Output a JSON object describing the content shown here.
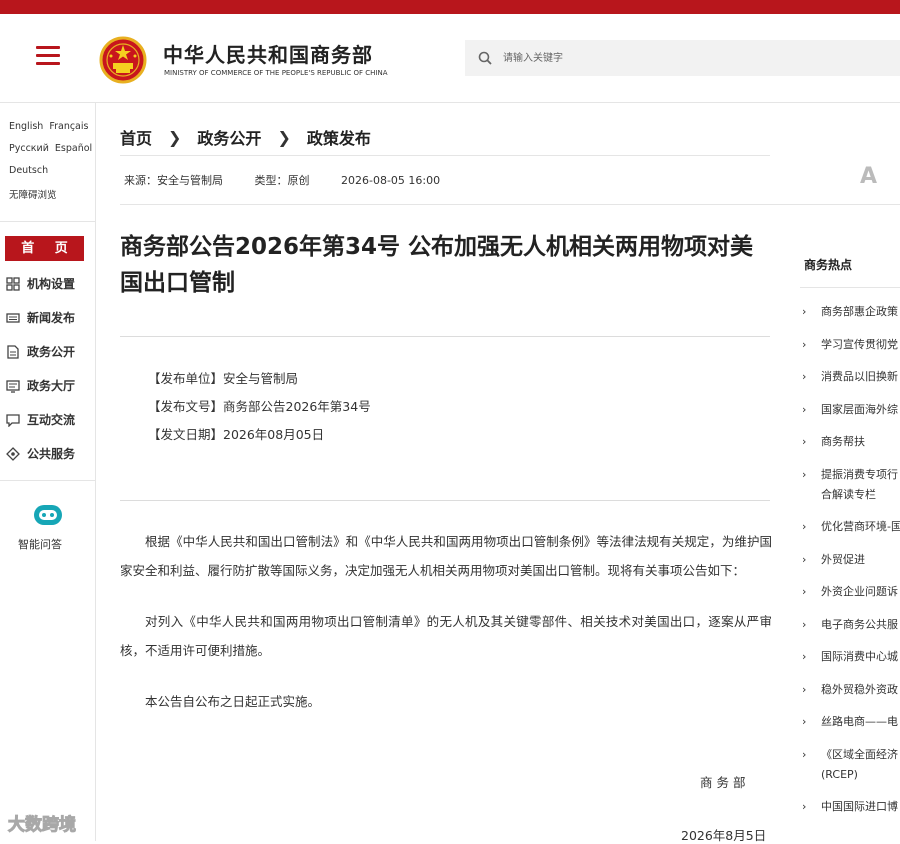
{
  "header": {
    "logo_cn": "中华人民共和国商务部",
    "logo_en": "MINISTRY OF COMMERCE OF THE PEOPLE'S REPUBLIC OF CHINA",
    "search_placeholder": "请输入关键字",
    "accent_color": "#b8161c"
  },
  "sidebar": {
    "languages": [
      "English",
      "Français",
      "Русский",
      "Español",
      "Deutsch",
      "无障碍浏览"
    ],
    "home": "首 页",
    "items": [
      {
        "label": "机构设置",
        "icon": "org-chart-icon"
      },
      {
        "label": "新闻发布",
        "icon": "news-icon"
      },
      {
        "label": "政务公开",
        "icon": "document-icon"
      },
      {
        "label": "政务大厅",
        "icon": "service-hall-icon"
      },
      {
        "label": "互动交流",
        "icon": "chat-icon"
      },
      {
        "label": "公共服务",
        "icon": "public-service-icon"
      }
    ],
    "ai_label": "智能问答"
  },
  "breadcrumb": [
    "首页",
    "政务公开",
    "政策发布"
  ],
  "meta": {
    "source": "来源：安全与管制局",
    "type": "类型：原创",
    "date": "2026-08-05 16:00",
    "font_button": "A"
  },
  "article": {
    "title": "商务部公告2026年第34号 公布加强无人机相关两用物项对美国出口管制",
    "info": [
      "【发布单位】安全与管制局",
      "【发布文号】商务部公告2026年第34号",
      "【发文日期】2026年08月05日"
    ],
    "paragraphs": [
      "根据《中华人民共和国出口管制法》和《中华人民共和国两用物项出口管制条例》等法律法规有关规定，为维护国家安全和利益、履行防扩散等国际义务，决定加强无人机相关两用物项对美国出口管制。现将有关事项公告如下：",
      "对列入《中华人民共和国两用物项出口管制清单》的无人机及其关键零部件、相关技术对美国出口，逐案从严审核，不适用许可便利措施。",
      "本公告自公布之日起正式实施。"
    ],
    "signature": "商务部",
    "sign_date": "2026年8月5日"
  },
  "hot": {
    "title": "商务热点",
    "items": [
      "商务部惠企政策",
      "学习宣传贯彻党",
      "消费品以旧换新",
      "国家层面海外综",
      "商务帮扶",
      "提振消费专项行",
      "合解读专栏",
      "优化营商环境-国",
      "外贸促进",
      "外资企业问题诉",
      "电子商务公共服",
      "国际消费中心城",
      "稳外贸稳外资政",
      "丝路电商——电",
      "《区域全面经济",
      "(RCEP)",
      "中国国际进口博"
    ]
  },
  "watermark": "大数跨境"
}
